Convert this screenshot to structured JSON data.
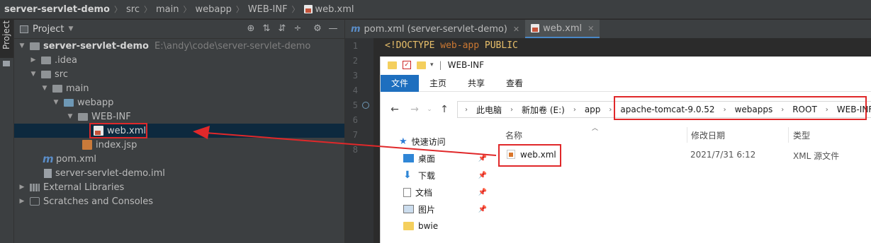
{
  "breadcrumb": [
    "server-servlet-demo",
    "src",
    "main",
    "webapp",
    "WEB-INF",
    "web.xml"
  ],
  "sidebar": {
    "tab_label": "Project"
  },
  "project_panel": {
    "title": "Project",
    "tools": [
      "target-icon",
      "collapse-icon",
      "expand-icon",
      "hide-icon",
      "gear-icon",
      "minimize-icon"
    ],
    "tree": [
      {
        "label": "server-servlet-demo",
        "path": "E:\\andy\\code\\server-servlet-demo"
      },
      {
        "label": ".idea"
      },
      {
        "label": "src"
      },
      {
        "label": "main"
      },
      {
        "label": "webapp"
      },
      {
        "label": "WEB-INF"
      },
      {
        "label": "web.xml",
        "selected": true
      },
      {
        "label": "index.jsp"
      },
      {
        "label": "pom.xml"
      },
      {
        "label": "server-servlet-demo.iml"
      },
      {
        "label": "External Libraries"
      },
      {
        "label": "Scratches and Consoles"
      }
    ]
  },
  "editor": {
    "tabs": [
      {
        "label": "pom.xml (server-servlet-demo)"
      },
      {
        "label": "web.xml",
        "active": true
      }
    ],
    "line_numbers": [
      "1",
      "2",
      "3",
      "4",
      "5",
      "6",
      "7",
      "8"
    ],
    "code_line1": {
      "a": "<!DOCTYPE",
      "b": " web-app ",
      "c": "PUBLIC"
    }
  },
  "explorer": {
    "title": "WEB-INF",
    "ribbon_tabs": [
      "文件",
      "主页",
      "共享",
      "查看"
    ],
    "address": [
      "此电脑",
      "新加卷 (E:)",
      "app",
      "apache-tomcat-9.0.52",
      "webapps",
      "ROOT",
      "WEB-INF"
    ],
    "quick_access": "快速访问",
    "nav_items": [
      "桌面",
      "下载",
      "文档",
      "图片",
      "bwie"
    ],
    "columns": {
      "name": "名称",
      "date": "修改日期",
      "type": "类型"
    },
    "files": [
      {
        "name": "web.xml",
        "date": "2021/7/31 6:12",
        "type": "XML 源文件"
      }
    ]
  },
  "colors": {
    "annotation": "#e0282a",
    "ide_bg": "#2b2b2b",
    "selection": "#0d293e",
    "file_tab": "#1e6fbf"
  }
}
